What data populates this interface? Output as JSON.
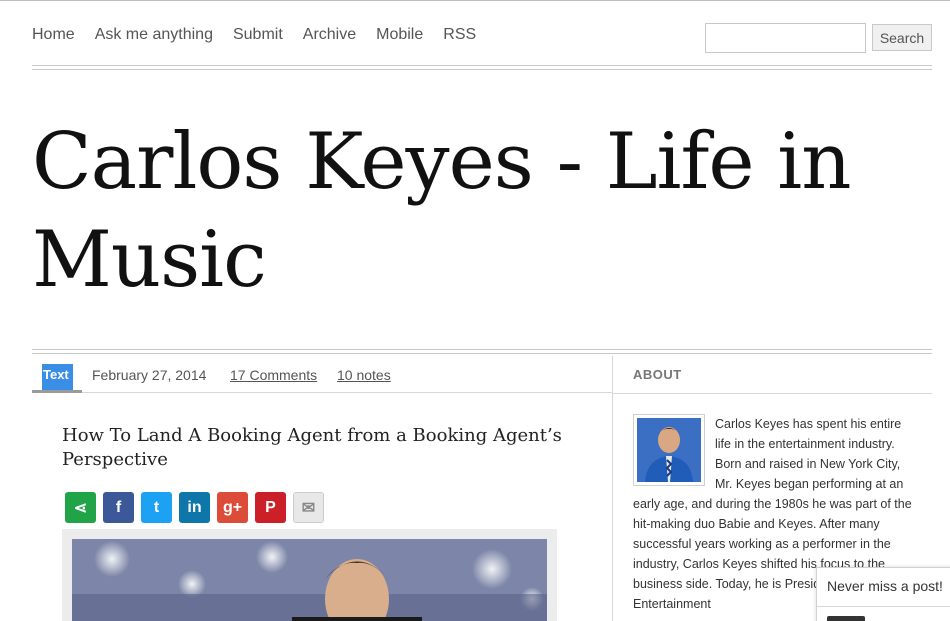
{
  "nav": {
    "items": [
      {
        "label": "Home"
      },
      {
        "label": "Ask me anything"
      },
      {
        "label": "Submit"
      },
      {
        "label": "Archive"
      },
      {
        "label": "Mobile"
      },
      {
        "label": "RSS"
      }
    ]
  },
  "search": {
    "placeholder": "",
    "value": "",
    "button_label": "Search"
  },
  "site": {
    "title": "Carlos Keyes - Life in Music"
  },
  "post": {
    "type_label": "Text",
    "date": "February 27, 2014",
    "comments": "17 Comments",
    "notes": "10 notes",
    "title": "How To Land A Booking Agent from a Booking Agent’s Perspective",
    "share_buttons": [
      {
        "name": "share-icon",
        "glyph": "⋖",
        "color": "#21a348"
      },
      {
        "name": "facebook-icon",
        "glyph": "f",
        "color": "#3b5998"
      },
      {
        "name": "twitter-icon",
        "glyph": "t",
        "color": "#1da1f2"
      },
      {
        "name": "linkedin-icon",
        "glyph": "in",
        "color": "#0e76a8"
      },
      {
        "name": "google-plus-icon",
        "glyph": "g+",
        "color": "#dd4b39"
      },
      {
        "name": "pinterest-icon",
        "glyph": "P",
        "color": "#cb2027"
      },
      {
        "name": "email-icon",
        "glyph": "✉",
        "color": "#e8e8e8"
      }
    ]
  },
  "about": {
    "heading": "ABOUT",
    "text": "Carlos Keyes has spent his entire life in the entertainment industry. Born and raised in New York City, Mr. Keyes began performing at an early age, and during the 1980s he was part of the hit-making duo Babie and Keyes. After many successful years working as a performer in the industry, Carlos Keyes shifted his focus to the business side. Today, he is President of Red Entertainment"
  },
  "popup": {
    "text": "Never miss a post!"
  },
  "colors": {
    "accent": "#3a8ee6",
    "title": "#111111",
    "link": "#555555"
  }
}
